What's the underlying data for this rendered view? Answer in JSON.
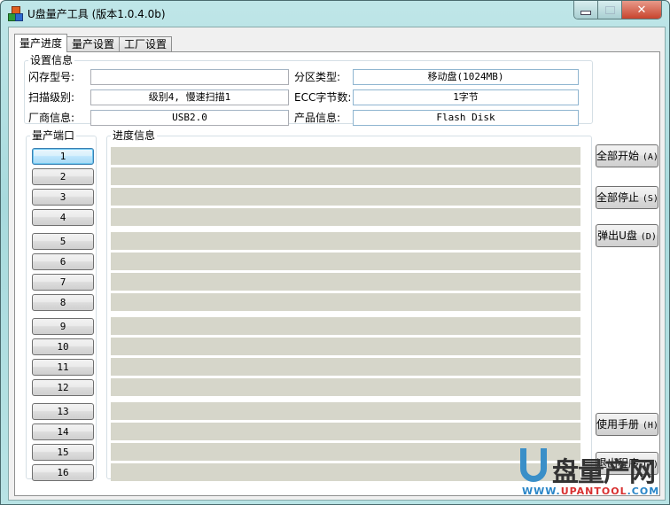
{
  "window": {
    "title": "U盘量产工具 (版本1.0.4.0b)",
    "controls": {
      "minimize": "—",
      "maximize": "□",
      "close": "✕"
    }
  },
  "tabs": [
    {
      "label": "量产进度",
      "active": true
    },
    {
      "label": "量产设置",
      "active": false
    },
    {
      "label": "工厂设置",
      "active": false
    }
  ],
  "settings": {
    "legend": "设置信息",
    "flash_model": {
      "label": "闪存型号:",
      "value": ""
    },
    "scan_level": {
      "label": "扫描级别:",
      "value": "级别4, 慢速扫描1"
    },
    "vendor_info": {
      "label": "厂商信息:",
      "value": "USB2.0"
    },
    "partition_type": {
      "label": "分区类型:",
      "value": "移动盘(1024MB)"
    },
    "ecc_bytes": {
      "label": "ECC字节数:",
      "value": "1字节"
    },
    "product_info": {
      "label": "产品信息:",
      "value": "Flash Disk"
    }
  },
  "ports": {
    "legend": "量产端口",
    "items": [
      "1",
      "2",
      "3",
      "4",
      "5",
      "6",
      "7",
      "8",
      "9",
      "10",
      "11",
      "12",
      "13",
      "14",
      "15",
      "16"
    ],
    "focused": "1"
  },
  "progress": {
    "legend": "进度信息",
    "bars": [
      0,
      0,
      0,
      0,
      0,
      0,
      0,
      0,
      0,
      0,
      0,
      0,
      0,
      0,
      0,
      0
    ]
  },
  "actions": {
    "start_all": {
      "label": "全部开始",
      "key": "(A)"
    },
    "stop_all": {
      "label": "全部停止",
      "key": "(S)"
    },
    "eject": {
      "label": "弹出U盘",
      "key": "(D)"
    },
    "manual": {
      "label": "使用手册",
      "key": "(H)"
    },
    "exit": {
      "label": "退出程序",
      "key": "(X)"
    }
  },
  "watermark": {
    "text": "盘量产网",
    "url_prefix": "WWW.",
    "url_brand": "UPANTOOL",
    "url_suffix": ".COM"
  },
  "colors": {
    "progress_bar_bg": "#d6d6ca",
    "focus_button": "#bee6fd",
    "close_button": "#c8442e",
    "watermark_blue": "#3a8fc8",
    "watermark_red": "#d83030"
  }
}
